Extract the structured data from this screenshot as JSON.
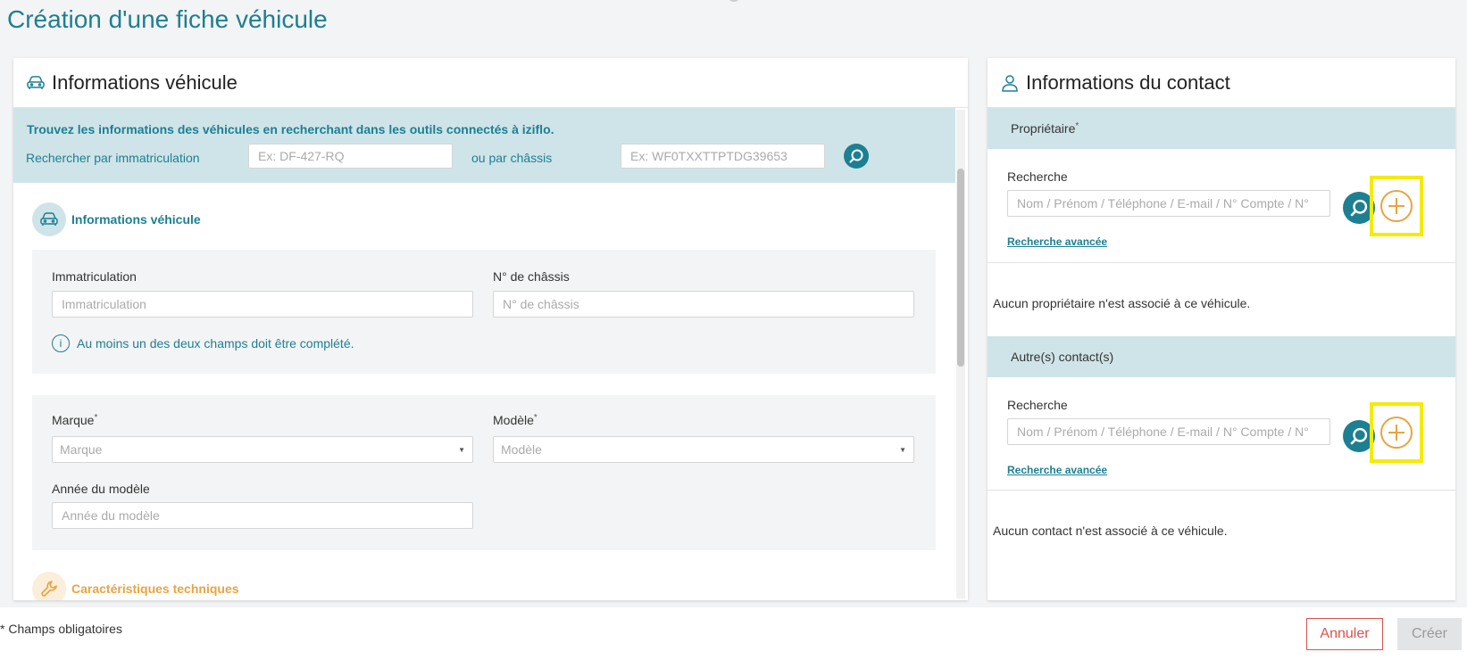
{
  "page": {
    "title": "Création d'une fiche véhicule"
  },
  "vehicle_panel": {
    "header_title": "Informations véhicule",
    "search_banner": {
      "title": "Trouvez les informations des véhicules en recherchant dans les outils connectés à iziflo.",
      "by_plate_label": "Rechercher par immatriculation",
      "plate_placeholder": "Ex: DF-427-RQ",
      "or_chassis_label": "ou par châssis",
      "chassis_placeholder": "Ex: WF0TXXTTPTDG39653"
    },
    "section_info": {
      "title": "Informations véhicule",
      "registration_label": "Immatriculation",
      "registration_placeholder": "Immatriculation",
      "chassis_label": "N° de châssis",
      "chassis_placeholder": "N° de châssis",
      "hint": "Au moins un des deux champs doit être complété.",
      "brand_label": "Marque",
      "brand_placeholder": "Marque",
      "model_label": "Modèle",
      "model_placeholder": "Modèle",
      "year_label": "Année du modèle",
      "year_placeholder": "Année du modèle",
      "required_mark": "*"
    },
    "section_tech": {
      "title": "Caractéristiques techniques"
    }
  },
  "contact_panel": {
    "header_title": "Informations du contact",
    "owner": {
      "bar_label": "Propriétaire",
      "required_mark": "*",
      "search_label": "Recherche",
      "search_placeholder": "Nom / Prénom / Téléphone / E-mail / N° Compte / N°",
      "advanced_link": "Recherche avancée",
      "empty_text": "Aucun propriétaire n'est associé à ce véhicule."
    },
    "others": {
      "bar_label": "Autre(s) contact(s)",
      "search_label": "Recherche",
      "search_placeholder": "Nom / Prénom / Téléphone / E-mail / N° Compte / N°",
      "advanced_link": "Recherche avancée",
      "empty_text": "Aucun contact n'est associé à ce véhicule."
    }
  },
  "footer": {
    "required_note": "* Champs obligatoires",
    "cancel_label": "Annuler",
    "create_label": "Créer"
  },
  "colors": {
    "accent": "#1d7f92",
    "banner_bg": "#cfe4e8",
    "tech_orange": "#e8a441",
    "highlight_yellow": "#f5ea00",
    "cancel_red": "#d9534f"
  }
}
